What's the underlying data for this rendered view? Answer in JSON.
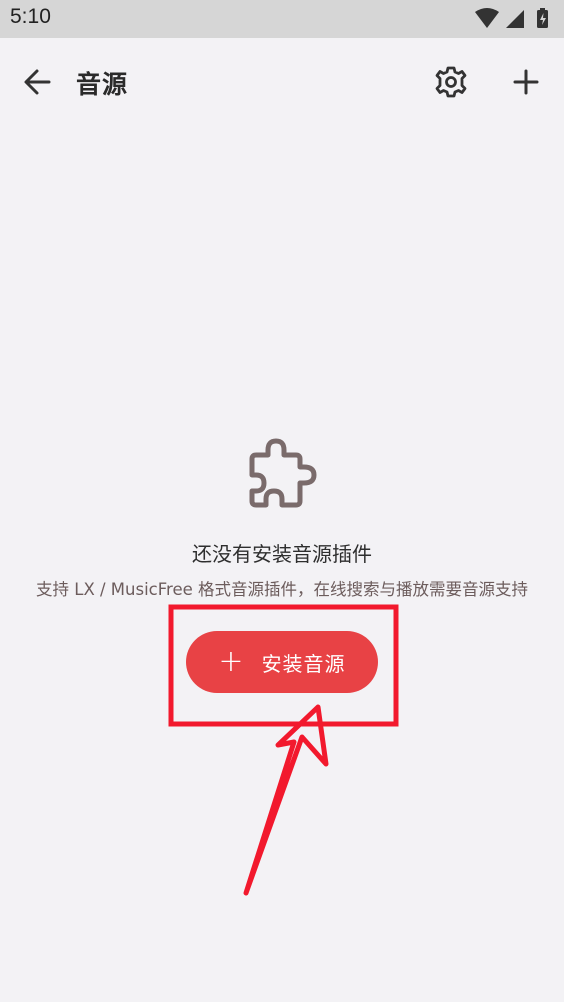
{
  "status_bar": {
    "time": "5:10"
  },
  "app_bar": {
    "title": "音源",
    "back_icon": "arrow-left-icon",
    "settings_icon": "gear-icon",
    "add_icon": "plus-icon"
  },
  "empty_state": {
    "icon": "puzzle-icon",
    "title": "还没有安装音源插件",
    "description": "支持 LX / MusicFree 格式音源插件，在线搜索与播放需要音源支持",
    "install_button": {
      "plus": "+",
      "label": "安装音源"
    }
  },
  "colors": {
    "accent": "#e84245",
    "background": "#f3f2f5",
    "annotation": "#f2192d"
  }
}
